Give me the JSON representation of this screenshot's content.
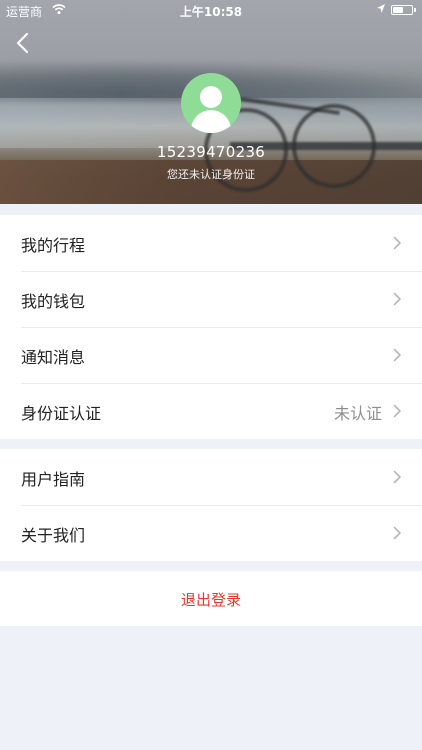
{
  "status_bar": {
    "carrier": "运营商",
    "time": "上午10:58",
    "battery_level": 0.55
  },
  "profile": {
    "phone": "15239470236",
    "verify_hint": "您还未认证身份证"
  },
  "menu_primary": [
    {
      "label": "我的行程",
      "value": ""
    },
    {
      "label": "我的钱包",
      "value": ""
    },
    {
      "label": "通知消息",
      "value": ""
    },
    {
      "label": "身份证认证",
      "value": "未认证"
    }
  ],
  "menu_secondary": [
    {
      "label": "用户指南",
      "value": ""
    },
    {
      "label": "关于我们",
      "value": ""
    }
  ],
  "logout": {
    "label": "退出登录"
  },
  "colors": {
    "page_background": "#eef1f8",
    "avatar": "#8fdc96",
    "logout_text": "#e8382d",
    "secondary_text": "#8e8e8e"
  },
  "icons": {
    "back": "chevron-left-icon",
    "wifi": "wifi-icon",
    "location": "location-arrow-icon",
    "battery": "battery-icon",
    "row_arrow": "chevron-right-icon",
    "avatar": "user-icon"
  }
}
